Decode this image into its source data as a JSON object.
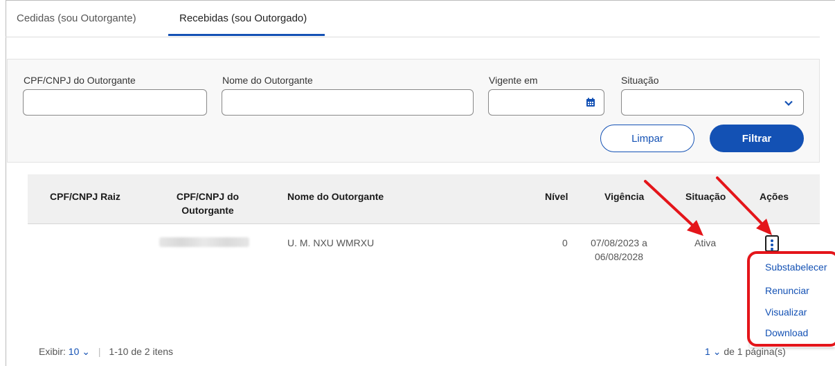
{
  "tabs": [
    {
      "label": "Cedidas (sou Outorgante)"
    },
    {
      "label": "Recebidas (sou Outorgado)"
    }
  ],
  "filters": {
    "cpf_label": "CPF/CNPJ do Outorgante",
    "cpf_value": "",
    "nome_label": "Nome do Outorgante",
    "nome_value": "",
    "vigente_label": "Vigente em",
    "vigente_value": "",
    "situacao_label": "Situação",
    "situacao_value": "",
    "limpar_label": "Limpar",
    "filtrar_label": "Filtrar"
  },
  "table": {
    "headers": {
      "cpf_raiz": "CPF/CNPJ Raiz",
      "cpf_outorgante_1": "CPF/CNPJ do",
      "cpf_outorgante_2": "Outorgante",
      "nome": "Nome do Outorgante",
      "nivel": "Nível",
      "vigencia": "Vigência",
      "situacao": "Situação",
      "acoes": "Ações"
    },
    "rows": [
      {
        "cpf_raiz": "",
        "nome": "U. M. NXU WMRXU",
        "nivel": "0",
        "vigencia_1": "07/08/2023 a",
        "vigencia_2": "06/08/2028",
        "situacao": "Ativa"
      }
    ]
  },
  "actions_menu": {
    "items": [
      "Substabelecer",
      "Renunciar",
      "Visualizar",
      "Download"
    ]
  },
  "footer": {
    "exibir_label": "Exibir:",
    "page_size": "10",
    "range_text": "1-10 de 2 itens",
    "current_page": "1",
    "pages_text": "de 1 página(s)"
  },
  "colors": {
    "primary": "#1351b4",
    "annotation_red": "#e4151a"
  }
}
